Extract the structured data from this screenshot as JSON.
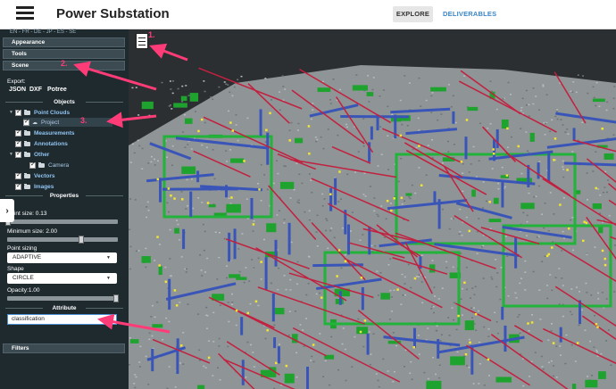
{
  "header": {
    "title": "Power Substation",
    "tabs": [
      "EXPLORE",
      "DELIVERABLES"
    ]
  },
  "sidebar": {
    "languages": "EN - FR - DE - JP - ES - SE",
    "accordions": {
      "appearance": "Appearance",
      "tools": "Tools",
      "scene": "Scene",
      "filters": "Filters"
    },
    "export": {
      "label": "Export:",
      "json": "JSON",
      "dxf": "DXF",
      "potree": "Potree"
    },
    "objects_heading": "Objects",
    "tree": {
      "point_clouds": "Point Clouds",
      "project": "Project",
      "measurements": "Measurements",
      "annotations": "Annotations",
      "other": "Other",
      "camera": "Camera",
      "vectors": "Vectors",
      "images": "Images"
    },
    "properties_heading": "Properties",
    "properties": {
      "point_size": "Point size: 0.13",
      "minimum_size": "Minimum size: 2.00",
      "point_sizing_label": "Point sizing",
      "point_sizing_value": "ADAPTIVE",
      "shape_label": "Shape",
      "shape_value": "CIRCLE",
      "opacity": "Opacity:1.00"
    },
    "attribute_heading": "Attribute",
    "attribute_value": "classification"
  },
  "annotations": {
    "one": "1.",
    "two": "2.",
    "three": "3."
  },
  "colors": {
    "accent": "#ff3c78",
    "sidebar": "#1f2a2f",
    "tab_link": "#3a86c8"
  }
}
